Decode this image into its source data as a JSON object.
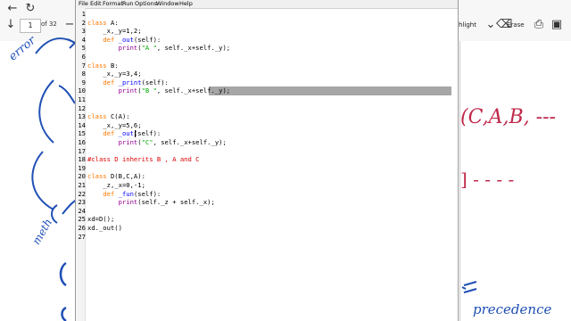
{
  "pdf_viewer": {
    "page_number": "1",
    "page_count": "of 32",
    "highlight_label": "hlight",
    "erase_label": "Erase",
    "handwriting_right_1": "(C,A,B, ---",
    "handwriting_right_2": "] - - - -",
    "handwriting_right_3": "precedence",
    "handwriting_left_1": "error",
    "handwriting_left_2": "meth"
  },
  "idle": {
    "menu": [
      "File",
      "Edit",
      "Format",
      "Run",
      "Options",
      "Window",
      "Help"
    ],
    "lines": [
      {
        "n": "1",
        "text": ""
      },
      {
        "n": "2",
        "text": "class A:"
      },
      {
        "n": "3",
        "text": "    _x,_y=1,2;"
      },
      {
        "n": "4",
        "text": "    def _out(self):"
      },
      {
        "n": "5",
        "text": "        print(\"A \", self._x+self._y);"
      },
      {
        "n": "6",
        "text": ""
      },
      {
        "n": "7",
        "text": "class B:"
      },
      {
        "n": "8",
        "text": "    _x,_y=3,4;"
      },
      {
        "n": "9",
        "text": "    def _print(self):"
      },
      {
        "n": "10",
        "text": "        print(\"B \", self._x+self._y);"
      },
      {
        "n": "11",
        "text": ""
      },
      {
        "n": "12",
        "text": ""
      },
      {
        "n": "13",
        "text": "class C(A):"
      },
      {
        "n": "14",
        "text": "    _x,_y=5,6;"
      },
      {
        "n": "15",
        "text": "    def _out(self):"
      },
      {
        "n": "16",
        "text": "        print(\"C\", self._x+self._y);"
      },
      {
        "n": "17",
        "text": ""
      },
      {
        "n": "18",
        "text": "#class D inherits B , A and C"
      },
      {
        "n": "19",
        "text": ""
      },
      {
        "n": "20",
        "text": "class D(B,C,A):"
      },
      {
        "n": "21",
        "text": "    _z,_x=0,-1;"
      },
      {
        "n": "22",
        "text": "    def _fun(self):"
      },
      {
        "n": "23",
        "text": "        print(self._z + self._x);"
      },
      {
        "n": "24",
        "text": ""
      },
      {
        "n": "25",
        "text": "xd=D();"
      },
      {
        "n": "26",
        "text": "xd._out()"
      },
      {
        "n": "27",
        "text": ""
      }
    ],
    "highlighted_line": "10"
  },
  "colors": {
    "keyword": "#ff7700",
    "defname": "#0000ff",
    "string": "#00aa00",
    "comment": "#dd0000",
    "ink_blue": "#1f4fb5",
    "ink_red": "#c0284a"
  }
}
